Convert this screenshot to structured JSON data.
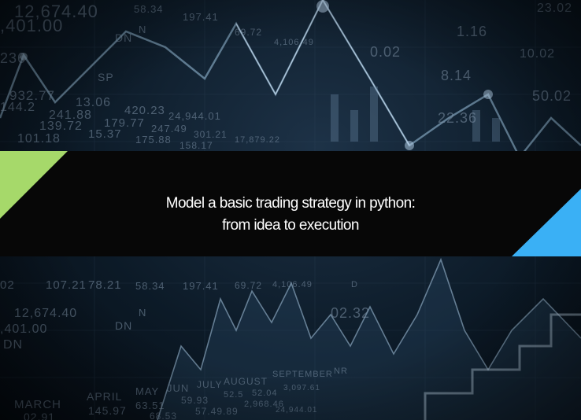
{
  "title": {
    "line1": "Model a basic trading strategy in python:",
    "line2": "from idea to execution"
  },
  "colors": {
    "band": "#070707",
    "accent_green": "#a6d96a",
    "accent_blue": "#3ab0f5",
    "title_text": "#ffffff"
  },
  "background_tickers": [
    "12,674.40",
    "58.34",
    "197.41",
    "69.72",
    "4,106.49",
    ",401.00",
    "DN",
    "N",
    "SP",
    "236",
    "932.77",
    "13.06",
    "420.23",
    "24,944.01",
    "144.2",
    "241.88",
    "179.77",
    "247.49",
    "301.21",
    "17,879.22",
    "139.72",
    "15.37",
    "175.88",
    "158.17",
    "101.18",
    "1.16",
    "0.02",
    "8.14",
    "50.02",
    "22.36",
    "10.02",
    "23.02",
    "02",
    "107.21",
    "78.21",
    "58.34",
    "197.41",
    "69.72",
    "4,106.49",
    "D",
    "12,674.40",
    "N",
    ",401.00",
    "DN",
    "DN",
    "02.32",
    "APRIL",
    "MAY",
    "JUN",
    "JULY",
    "AUGUST",
    "SEPTEMBER",
    "NR",
    "MARCH",
    "145.97",
    "63.51",
    "59.93",
    "52.5",
    "52.04",
    "3,097.61",
    "02.91",
    "68.53",
    "57.49.89",
    "2,968.46",
    "24,944.01"
  ],
  "icons": {
    "left_corner": "green-triangle-icon",
    "right_corner": "blue-triangle-icon"
  }
}
